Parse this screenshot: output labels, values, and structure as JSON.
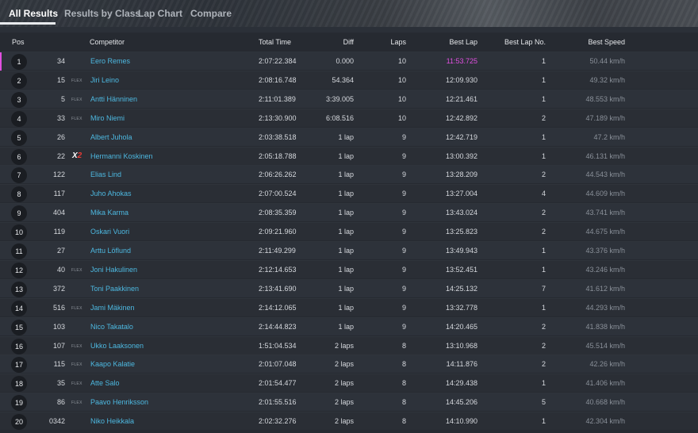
{
  "tabs": [
    {
      "label": "All Results",
      "active": true
    },
    {
      "label": "Results by Class",
      "active": false
    },
    {
      "label": "Lap Chart",
      "active": false
    },
    {
      "label": "Compare",
      "active": false
    }
  ],
  "columns": {
    "pos": "Pos",
    "competitor": "Competitor",
    "total_time": "Total Time",
    "diff": "Diff",
    "laps": "Laps",
    "best_lap": "Best Lap",
    "best_lap_no": "Best Lap No.",
    "best_speed": "Best Speed"
  },
  "colors": {
    "competitor_link": "#4db8e0",
    "fastest_lap": "#e04fe0",
    "x2_accent": "#e53935"
  },
  "rows": [
    {
      "pos": "1",
      "num": "34",
      "badge": "",
      "competitor": "Eero Remes",
      "total_time": "2:07:22.384",
      "diff": "0.000",
      "laps": "10",
      "best_lap": "11:53.725",
      "best_lap_no": "1",
      "best_speed": "50.44 km/h",
      "fastest": true
    },
    {
      "pos": "2",
      "num": "15",
      "badge": "FLEX",
      "competitor": "Jiri Leino",
      "total_time": "2:08:16.748",
      "diff": "54.364",
      "laps": "10",
      "best_lap": "12:09.930",
      "best_lap_no": "1",
      "best_speed": "49.32 km/h"
    },
    {
      "pos": "3",
      "num": "5",
      "badge": "FLEX",
      "competitor": "Antti Hänninen",
      "total_time": "2:11:01.389",
      "diff": "3:39.005",
      "laps": "10",
      "best_lap": "12:21.461",
      "best_lap_no": "1",
      "best_speed": "48.553 km/h"
    },
    {
      "pos": "4",
      "num": "33",
      "badge": "FLEX",
      "competitor": "Miro Niemi",
      "total_time": "2:13:30.900",
      "diff": "6:08.516",
      "laps": "10",
      "best_lap": "12:42.892",
      "best_lap_no": "2",
      "best_speed": "47.189 km/h"
    },
    {
      "pos": "5",
      "num": "26",
      "badge": "",
      "competitor": "Albert Juhola",
      "total_time": "2:03:38.518",
      "diff": "1 lap",
      "laps": "9",
      "best_lap": "12:42.719",
      "best_lap_no": "1",
      "best_speed": "47.2 km/h"
    },
    {
      "pos": "6",
      "num": "22",
      "badge": "X2",
      "competitor": "Hermanni Koskinen",
      "total_time": "2:05:18.788",
      "diff": "1 lap",
      "laps": "9",
      "best_lap": "13:00.392",
      "best_lap_no": "1",
      "best_speed": "46.131 km/h"
    },
    {
      "pos": "7",
      "num": "122",
      "badge": "",
      "competitor": "Elias Lind",
      "total_time": "2:06:26.262",
      "diff": "1 lap",
      "laps": "9",
      "best_lap": "13:28.209",
      "best_lap_no": "2",
      "best_speed": "44.543 km/h"
    },
    {
      "pos": "8",
      "num": "117",
      "badge": "",
      "competitor": "Juho Ahokas",
      "total_time": "2:07:00.524",
      "diff": "1 lap",
      "laps": "9",
      "best_lap": "13:27.004",
      "best_lap_no": "4",
      "best_speed": "44.609 km/h"
    },
    {
      "pos": "9",
      "num": "404",
      "badge": "",
      "competitor": "Mika Karma",
      "total_time": "2:08:35.359",
      "diff": "1 lap",
      "laps": "9",
      "best_lap": "13:43.024",
      "best_lap_no": "2",
      "best_speed": "43.741 km/h"
    },
    {
      "pos": "10",
      "num": "119",
      "badge": "",
      "competitor": "Oskari Vuori",
      "total_time": "2:09:21.960",
      "diff": "1 lap",
      "laps": "9",
      "best_lap": "13:25.823",
      "best_lap_no": "2",
      "best_speed": "44.675 km/h"
    },
    {
      "pos": "11",
      "num": "27",
      "badge": "",
      "competitor": "Arttu Löflund",
      "total_time": "2:11:49.299",
      "diff": "1 lap",
      "laps": "9",
      "best_lap": "13:49.943",
      "best_lap_no": "1",
      "best_speed": "43.376 km/h"
    },
    {
      "pos": "12",
      "num": "40",
      "badge": "FLEX",
      "competitor": "Joni Hakulinen",
      "total_time": "2:12:14.653",
      "diff": "1 lap",
      "laps": "9",
      "best_lap": "13:52.451",
      "best_lap_no": "1",
      "best_speed": "43.246 km/h"
    },
    {
      "pos": "13",
      "num": "372",
      "badge": "",
      "competitor": "Toni Paakkinen",
      "total_time": "2:13:41.690",
      "diff": "1 lap",
      "laps": "9",
      "best_lap": "14:25.132",
      "best_lap_no": "7",
      "best_speed": "41.612 km/h"
    },
    {
      "pos": "14",
      "num": "516",
      "badge": "FLEX",
      "competitor": "Jami Mäkinen",
      "total_time": "2:14:12.065",
      "diff": "1 lap",
      "laps": "9",
      "best_lap": "13:32.778",
      "best_lap_no": "1",
      "best_speed": "44.293 km/h"
    },
    {
      "pos": "15",
      "num": "103",
      "badge": "",
      "competitor": "Nico Takatalo",
      "total_time": "2:14:44.823",
      "diff": "1 lap",
      "laps": "9",
      "best_lap": "14:20.465",
      "best_lap_no": "2",
      "best_speed": "41.838 km/h"
    },
    {
      "pos": "16",
      "num": "107",
      "badge": "FLEX",
      "competitor": "Ukko Laaksonen",
      "total_time": "1:51:04.534",
      "diff": "2 laps",
      "laps": "8",
      "best_lap": "13:10.968",
      "best_lap_no": "2",
      "best_speed": "45.514 km/h"
    },
    {
      "pos": "17",
      "num": "115",
      "badge": "FLEX",
      "competitor": "Kaapo Kalatie",
      "total_time": "2:01:07.048",
      "diff": "2 laps",
      "laps": "8",
      "best_lap": "14:11.876",
      "best_lap_no": "2",
      "best_speed": "42.26 km/h"
    },
    {
      "pos": "18",
      "num": "35",
      "badge": "FLEX",
      "competitor": "Atte Salo",
      "total_time": "2:01:54.477",
      "diff": "2 laps",
      "laps": "8",
      "best_lap": "14:29.438",
      "best_lap_no": "1",
      "best_speed": "41.406 km/h"
    },
    {
      "pos": "19",
      "num": "86",
      "badge": "FLEX",
      "competitor": "Paavo Henriksson",
      "total_time": "2:01:55.516",
      "diff": "2 laps",
      "laps": "8",
      "best_lap": "14:45.206",
      "best_lap_no": "5",
      "best_speed": "40.668 km/h"
    },
    {
      "pos": "20",
      "num": "0342",
      "badge": "",
      "competitor": "Niko Heikkala",
      "total_time": "2:02:32.276",
      "diff": "2 laps",
      "laps": "8",
      "best_lap": "14:10.990",
      "best_lap_no": "1",
      "best_speed": "42.304 km/h"
    }
  ]
}
